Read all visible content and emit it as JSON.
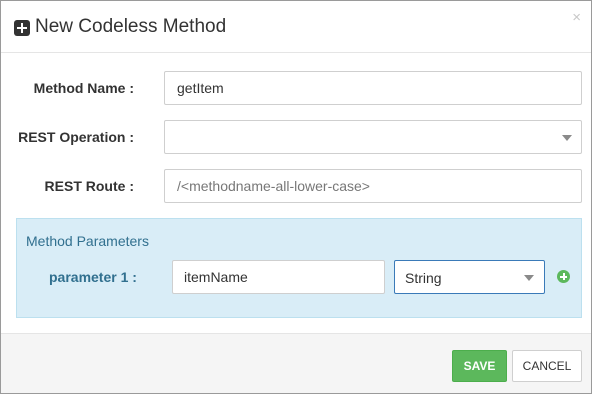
{
  "dialog": {
    "title": "New Codeless Method",
    "close_glyph": "×",
    "header_icon": "plus-square-icon"
  },
  "form": {
    "method_name": {
      "label": "Method Name :",
      "value": "getItem"
    },
    "rest_operation": {
      "label": "REST Operation :",
      "value": ""
    },
    "rest_route": {
      "label": "REST Route :",
      "value": "",
      "placeholder": "/<methodname-all-lower-case>"
    }
  },
  "parameters": {
    "title": "Method Parameters",
    "items": [
      {
        "label": "parameter 1 :",
        "name": "itemName",
        "type": "String"
      }
    ],
    "add_icon": "plus-circle-icon"
  },
  "footer": {
    "save_label": "SAVE",
    "cancel_label": "CANCEL"
  },
  "colors": {
    "accent_green": "#5cb85c",
    "panel_blue": "#d9edf7",
    "panel_text": "#31708f",
    "focus_border": "#3a7ab8"
  }
}
